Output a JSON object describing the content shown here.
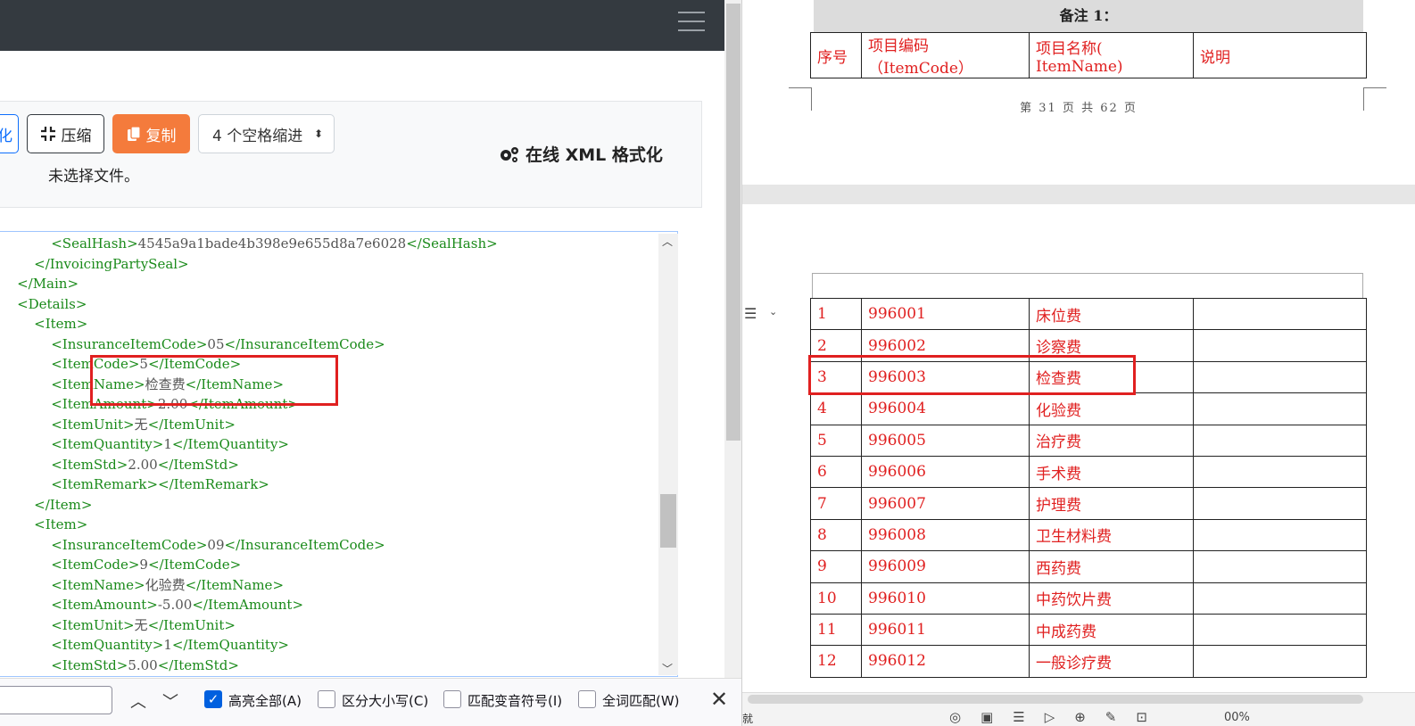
{
  "toolbar": {
    "edge_button_label": "化",
    "compress_label": "压缩",
    "copy_label": "复制",
    "indent_select": "4 个空格缩进",
    "file_status": "未选择文件。",
    "brand_title": "在线 XML 格式化"
  },
  "icons": {
    "compress": "compress-icon",
    "copy": "copy-icon",
    "brand": "gears-icon",
    "menu": "hamburger-icon"
  },
  "xml_lines": [
    {
      "indent": 8,
      "open": "<SealHash>",
      "text": "4545a9a1bade4b398e9e655d8a7e6028",
      "close": "</SealHash>"
    },
    {
      "indent": 6,
      "open": "</InvoicingPartySeal>",
      "text": "",
      "close": ""
    },
    {
      "indent": 4,
      "open": "</Main>",
      "text": "",
      "close": ""
    },
    {
      "indent": 4,
      "open": "<Details>",
      "text": "",
      "close": ""
    },
    {
      "indent": 6,
      "open": "<Item>",
      "text": "",
      "close": ""
    },
    {
      "indent": 8,
      "open": "<InsuranceItemCode>",
      "text": "05",
      "close": "</InsuranceItemCode>"
    },
    {
      "indent": 8,
      "open": "<ItemCode>",
      "text": "5",
      "close": "</ItemCode>"
    },
    {
      "indent": 8,
      "open": "<ItemName>",
      "text": "检查费",
      "close": "</ItemName>"
    },
    {
      "indent": 8,
      "open": "<ItemAmount>",
      "text": "2.00",
      "close": "</ItemAmount>"
    },
    {
      "indent": 8,
      "open": "<ItemUnit>",
      "text": "无",
      "close": "</ItemUnit>"
    },
    {
      "indent": 8,
      "open": "<ItemQuantity>",
      "text": "1",
      "close": "</ItemQuantity>"
    },
    {
      "indent": 8,
      "open": "<ItemStd>",
      "text": "2.00",
      "close": "</ItemStd>"
    },
    {
      "indent": 8,
      "open": "<ItemRemark>",
      "text": "",
      "close": "</ItemRemark>"
    },
    {
      "indent": 6,
      "open": "</Item>",
      "text": "",
      "close": ""
    },
    {
      "indent": 6,
      "open": "<Item>",
      "text": "",
      "close": ""
    },
    {
      "indent": 8,
      "open": "<InsuranceItemCode>",
      "text": "09",
      "close": "</InsuranceItemCode>"
    },
    {
      "indent": 8,
      "open": "<ItemCode>",
      "text": "9",
      "close": "</ItemCode>"
    },
    {
      "indent": 8,
      "open": "<ItemName>",
      "text": "化验费",
      "close": "</ItemName>"
    },
    {
      "indent": 8,
      "open": "<ItemAmount>",
      "text": "-5.00",
      "close": "</ItemAmount>"
    },
    {
      "indent": 8,
      "open": "<ItemUnit>",
      "text": "无",
      "close": "</ItemUnit>"
    },
    {
      "indent": 8,
      "open": "<ItemQuantity>",
      "text": "1",
      "close": "</ItemQuantity>"
    },
    {
      "indent": 8,
      "open": "<ItemStd>",
      "text": "5.00",
      "close": "</ItemStd>"
    }
  ],
  "findbar": {
    "input_value": "",
    "highlight_all": "高亮全部(A)",
    "match_case": "区分大小写(C)",
    "match_diacritics": "匹配变音符号(I)",
    "whole_words": "全词匹配(W)"
  },
  "document": {
    "remark_title": "备注 1：",
    "header_cols": [
      "序号",
      "项目编码（ItemCode）",
      "项目名称( ItemName)",
      "说明"
    ],
    "page_footer": "第 31 页 共 62 页",
    "rows": [
      [
        "1",
        "996001",
        "床位费",
        ""
      ],
      [
        "2",
        "996002",
        "诊察费",
        ""
      ],
      [
        "3",
        "996003",
        "检查费",
        ""
      ],
      [
        "4",
        "996004",
        "化验费",
        ""
      ],
      [
        "5",
        "996005",
        "治疗费",
        ""
      ],
      [
        "6",
        "996006",
        "手术费",
        ""
      ],
      [
        "7",
        "996007",
        "护理费",
        ""
      ],
      [
        "8",
        "996008",
        "卫生材料费",
        ""
      ],
      [
        "9",
        "996009",
        "西药费",
        ""
      ],
      [
        "10",
        "996010",
        "中药饮片费",
        ""
      ],
      [
        "11",
        "996011",
        "中成药费",
        ""
      ],
      [
        "12",
        "996012",
        "一般诊疗费",
        ""
      ]
    ],
    "status_text": "就",
    "zoom": "00%"
  },
  "colors": {
    "annotation_red": "#e02020",
    "xml_tag_green": "#1a8a1a",
    "copy_orange": "#f47b3c",
    "topbar_dark": "#343a40"
  }
}
